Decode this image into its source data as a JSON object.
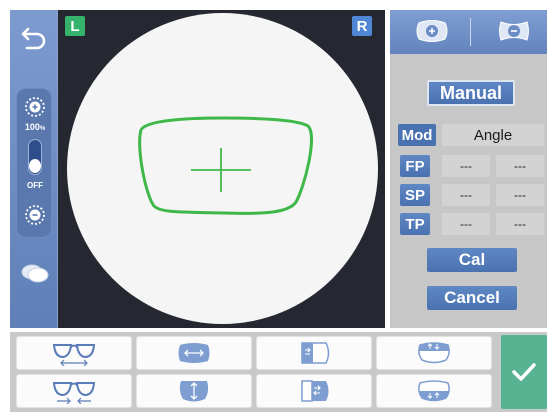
{
  "colors": {
    "sidebar": "#6b8cc4",
    "viewport": "#252731",
    "frame_outline": "#3fb84a",
    "left_badge": "#35b26b",
    "right_badge": "#4f86d6",
    "button_blue": "#4a72b0",
    "confirm_green": "#57b391"
  },
  "sidebar": {
    "back_icon": "back-arrow-icon",
    "brightness_percent": "100",
    "brightness_unit": "%",
    "toggle_state": "OFF",
    "brightness_up_icon": "brightness-up-icon",
    "brightness_down_icon": "brightness-down-icon",
    "lens_stack_icon": "lens-stack-icon"
  },
  "viewport": {
    "left_badge": "L",
    "right_badge": "R"
  },
  "right_panel": {
    "plus_icon": "plus-lens-icon",
    "minus_icon": "minus-lens-icon",
    "mode_button": "Manual",
    "mod_label": "Mod",
    "mod_value": "Angle",
    "rows": [
      {
        "label": "FP",
        "a": "---",
        "b": "---"
      },
      {
        "label": "SP",
        "a": "---",
        "b": "---"
      },
      {
        "label": "TP",
        "a": "---",
        "b": "---"
      }
    ],
    "cal_button": "Cal",
    "cancel_button": "Cancel"
  },
  "bottom_bar": {
    "row1": [
      "frame-width-icon",
      "horizontal-shift-icon",
      "nasal-cut-icon",
      "top-shift-icon"
    ],
    "row2": [
      "frame-narrow-icon",
      "vertical-shift-icon",
      "nasal-shift-icon",
      "bottom-shift-icon"
    ],
    "confirm_icon": "checkmark-icon"
  }
}
